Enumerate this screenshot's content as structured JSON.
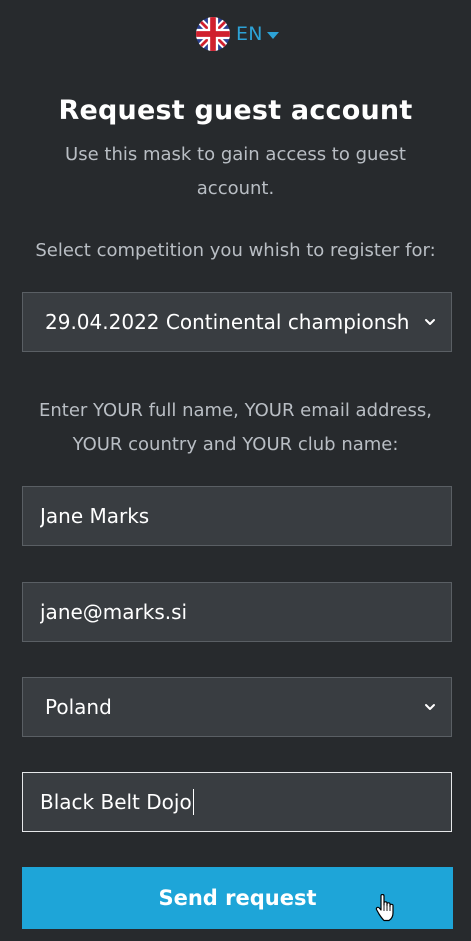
{
  "header": {
    "language": {
      "code": "EN",
      "flag": "uk-flag-icon"
    }
  },
  "form": {
    "title": "Request guest account",
    "subtitle": "Use this mask to gain access to guest account.",
    "competition_label": "Select competition you whish to register for:",
    "competition_selected": "29.04.2022 Continental championsh",
    "details_label": "Enter YOUR full name, YOUR email address, YOUR country and YOUR club name:",
    "full_name": "Jane Marks",
    "email": "jane@marks.si",
    "country_selected": "Poland",
    "club_name": "Black Belt Dojo",
    "submit_label": "Send request"
  },
  "colors": {
    "background": "#272a2d",
    "field_background": "#393d41",
    "accent": "#1ea5d8",
    "link": "#2da2d6"
  }
}
